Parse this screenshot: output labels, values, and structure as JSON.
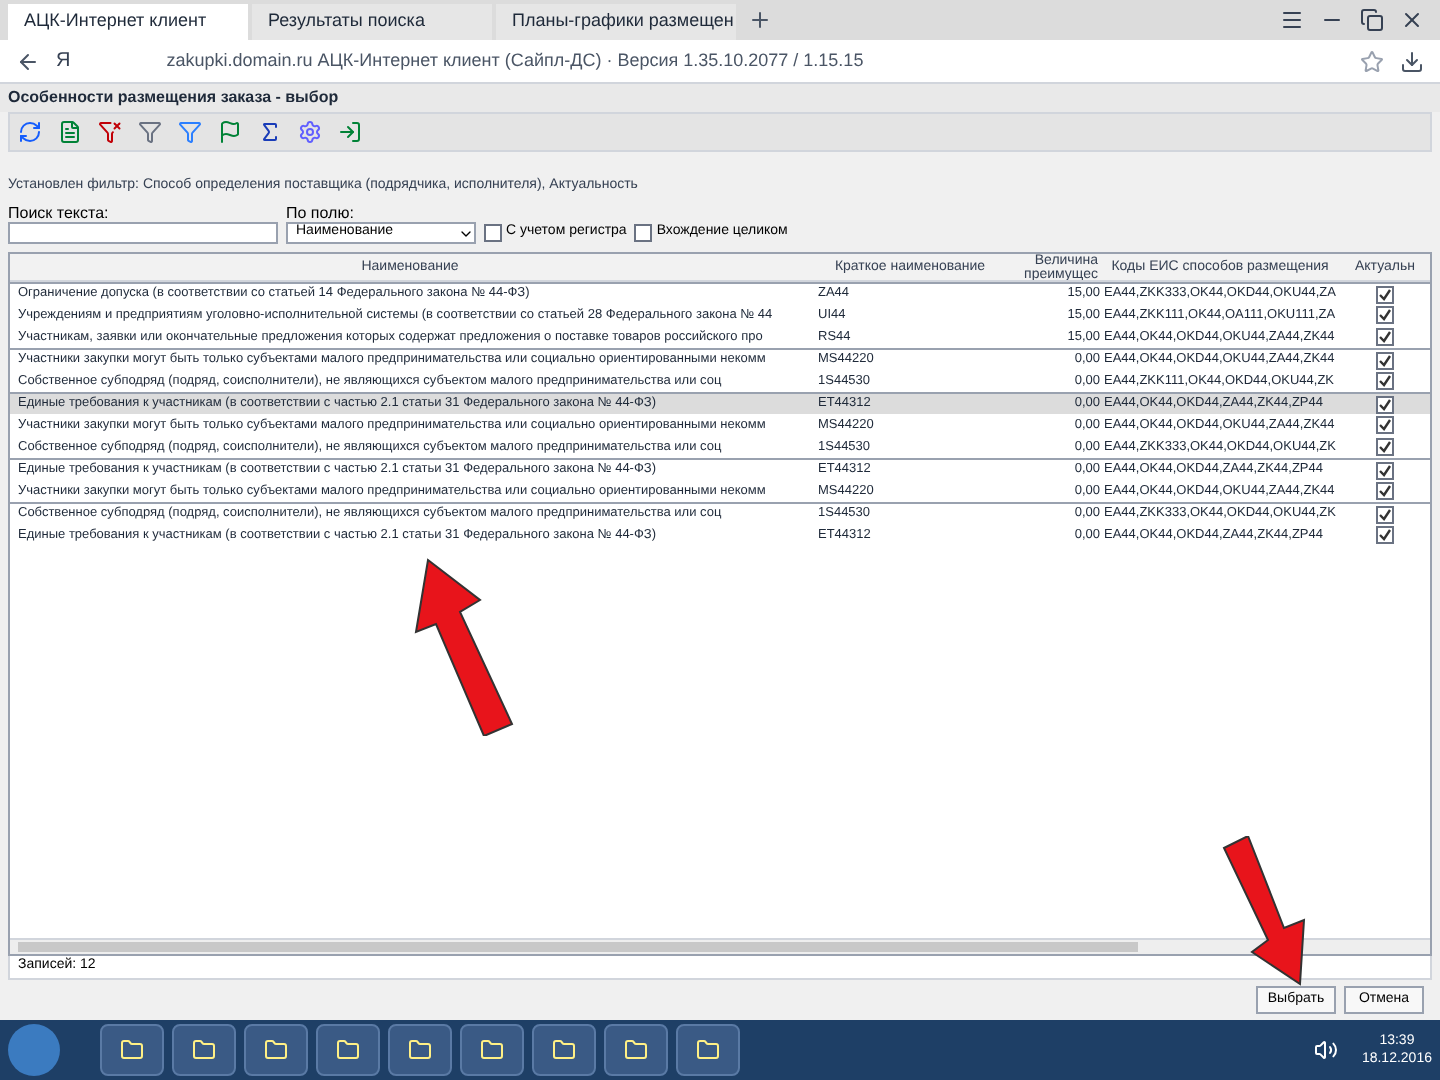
{
  "browser": {
    "tabs": [
      {
        "label": "АЦК-Интернет клиент",
        "selected": true
      },
      {
        "label": "Результаты поиска",
        "selected": false
      },
      {
        "label": "Планы-графики размещен",
        "selected": false
      }
    ],
    "address": "zakupki.domain.ru АЦК-Интернет клиент (Сайпл-ДС) · Версия 1.35.10.2077 / 1.15.15",
    "home": "Я"
  },
  "window": {
    "title": "Особенности размещения заказа - выбор"
  },
  "filter_text": "Установлен фильтр: Способ определения поставщика (подрядчика, исполнителя), Актуальность",
  "search": {
    "label": "Поиск текста:",
    "field_label": "По полю:",
    "field_value": "Наименование",
    "options": [
      {
        "label": "С учетом регистра",
        "checked": false
      },
      {
        "label": "Вхождение целиком",
        "checked": false
      }
    ]
  },
  "table": {
    "columns": [
      "Наименование",
      "Краткое наименование",
      "Величина преимущес",
      "Коды ЕИС способов размещения",
      "Актуальн"
    ],
    "rows": [
      {
        "name": "Ограничение допуска (в соответствии со статьей 14 Федерального закона № 44-ФЗ)",
        "short": "ZA44",
        "value": "15,00",
        "codes": "EA44,ZKK333,OK44,OKD44,OKU44,ZA",
        "actual": true,
        "selected": false,
        "group_start": true
      },
      {
        "name": "Учреждениям и предприятиям уголовно-исполнительной системы (в соответствии со статьей 28 Федерального закона № 44",
        "short": "UI44",
        "value": "15,00",
        "codes": "EA44,ZKK111,OK44,OA111,OKU111,ZA",
        "actual": true,
        "selected": false,
        "group_start": false
      },
      {
        "name": "Участникам, заявки или окончательные предложения которых содержат предложения о поставке товаров российского про",
        "short": "RS44",
        "value": "15,00",
        "codes": "EA44,OK44,OKD44,OKU44,ZA44,ZK44",
        "actual": true,
        "selected": false,
        "group_start": false
      },
      {
        "name": "Участники закупки могут быть только субъектами малого предпринимательства или социально ориентированными некомм",
        "short": "MS44220",
        "value": "0,00",
        "codes": "EA44,OK44,OKD44,OKU44,ZA44,ZK44",
        "actual": true,
        "selected": false,
        "group_start": true
      },
      {
        "name": "  Собственное субподряд (подряд, соисполнители), не являющихся субъектом малого предпринимательства или соц",
        "short": "1S44530",
        "value": "0,00",
        "codes": "EA44,ZKK111,OK44,OKD44,OKU44,ZK",
        "actual": true,
        "selected": false,
        "group_start": false
      },
      {
        "name": "Единые требования к участникам (в соответствии с частью 2.1 статьи 31 Федерального закона № 44-ФЗ)",
        "short": "ET44312",
        "value": "0,00",
        "codes": "EA44,OK44,OKD44,ZA44,ZK44,ZP44",
        "actual": true,
        "selected": true,
        "group_start": true
      },
      {
        "name": "Участники закупки могут быть только субъектами малого предпринимательства или социально ориентированными некомм",
        "short": "MS44220",
        "value": "0,00",
        "codes": "EA44,OK44,OKD44,OKU44,ZA44,ZK44",
        "actual": true,
        "selected": false,
        "group_start": false
      },
      {
        "name": "  Собственное субподряд (подряд, соисполнители), не являющихся субъектом малого предпринимательства или соц",
        "short": "1S44530",
        "value": "0,00",
        "codes": "EA44,ZKK333,OK44,OKD44,OKU44,ZK",
        "actual": true,
        "selected": false,
        "group_start": false
      },
      {
        "name": "Единые требования к участникам (в соответствии с частью 2.1 статьи 31 Федерального закона № 44-ФЗ)",
        "short": "ET44312",
        "value": "0,00",
        "codes": "EA44,OK44,OKD44,ZA44,ZK44,ZP44",
        "actual": true,
        "selected": false,
        "group_start": true
      },
      {
        "name": "Участники закупки могут быть только субъектами малого предпринимательства или социально ориентированными некомм",
        "short": "MS44220",
        "value": "0,00",
        "codes": "EA44,OK44,OKD44,OKU44,ZA44,ZK44",
        "actual": true,
        "selected": false,
        "group_start": false
      },
      {
        "name": "  Собственное субподряд (подряд, соисполнители), не являющихся субъектом малого предпринимательства или соц",
        "short": "1S44530",
        "value": "0,00",
        "codes": "EA44,ZKK333,OK44,OKD44,OKU44,ZK",
        "actual": true,
        "selected": false,
        "group_start": true
      },
      {
        "name": "Единые требования к участникам (в соответствии с частью 2.1 статьи 31 Федерального закона № 44-ФЗ)",
        "short": "ET44312",
        "value": "0,00",
        "codes": "EA44,OK44,OKD44,ZA44,ZK44,ZP44",
        "actual": true,
        "selected": false,
        "group_start": false
      }
    ]
  },
  "record_count": "Записей: 12",
  "buttons": [
    "Выбрать",
    "Отмена"
  ],
  "taskbar": {
    "time": "13:39",
    "date": "18.12.2016"
  }
}
